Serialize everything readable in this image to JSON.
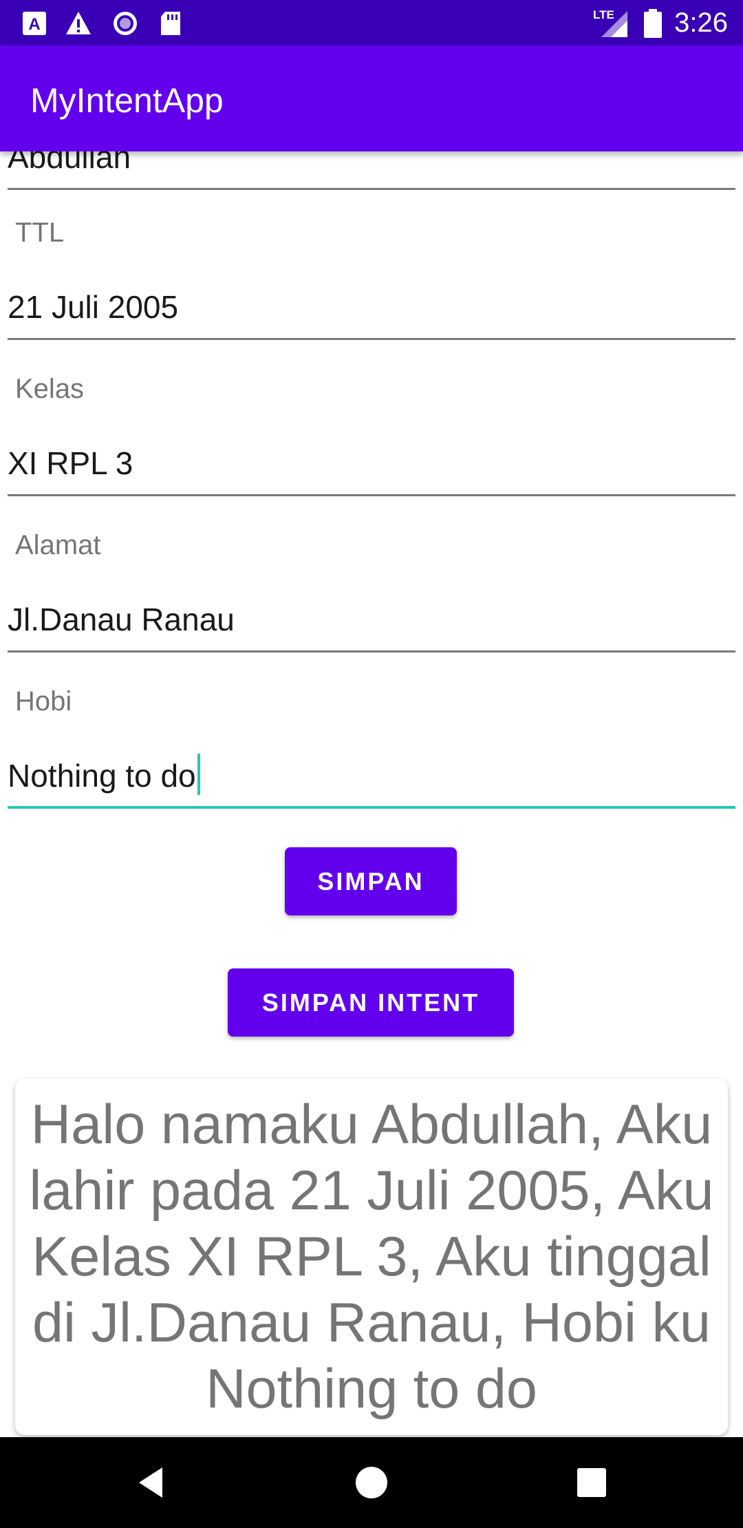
{
  "status_bar": {
    "time": "3:26",
    "network_label": "LTE",
    "icons": [
      "app-a-icon",
      "warning-icon",
      "circle-record-icon",
      "sd-card-icon",
      "lte-signal-icon",
      "battery-icon"
    ]
  },
  "app_bar": {
    "title": "MyIntentApp"
  },
  "form": {
    "nama": {
      "value": "Abdullah"
    },
    "ttl": {
      "label": "TTL",
      "value": "21 Juli 2005"
    },
    "kelas": {
      "label": "Kelas",
      "value": "XI RPL 3"
    },
    "alamat": {
      "label": "Alamat",
      "value": "Jl.Danau Ranau"
    },
    "hobi": {
      "label": "Hobi",
      "value": "Nothing to do"
    }
  },
  "buttons": {
    "simpan": "SIMPAN",
    "simpan_intent": "SIMPAN INTENT"
  },
  "result_text": "Halo namaku Abdullah, Aku lahir pada 21 Juli 2005, Aku Kelas XI RPL 3, Aku tinggal di Jl.Danau Ranau, Hobi ku Nothing to do",
  "colors": {
    "status_bar": "#3a00b5",
    "primary": "#6200ee",
    "accent": "#26c6b6",
    "hint_text": "#757575"
  },
  "nav_bar": {
    "icons": [
      "back-icon",
      "home-icon",
      "recents-icon"
    ]
  }
}
